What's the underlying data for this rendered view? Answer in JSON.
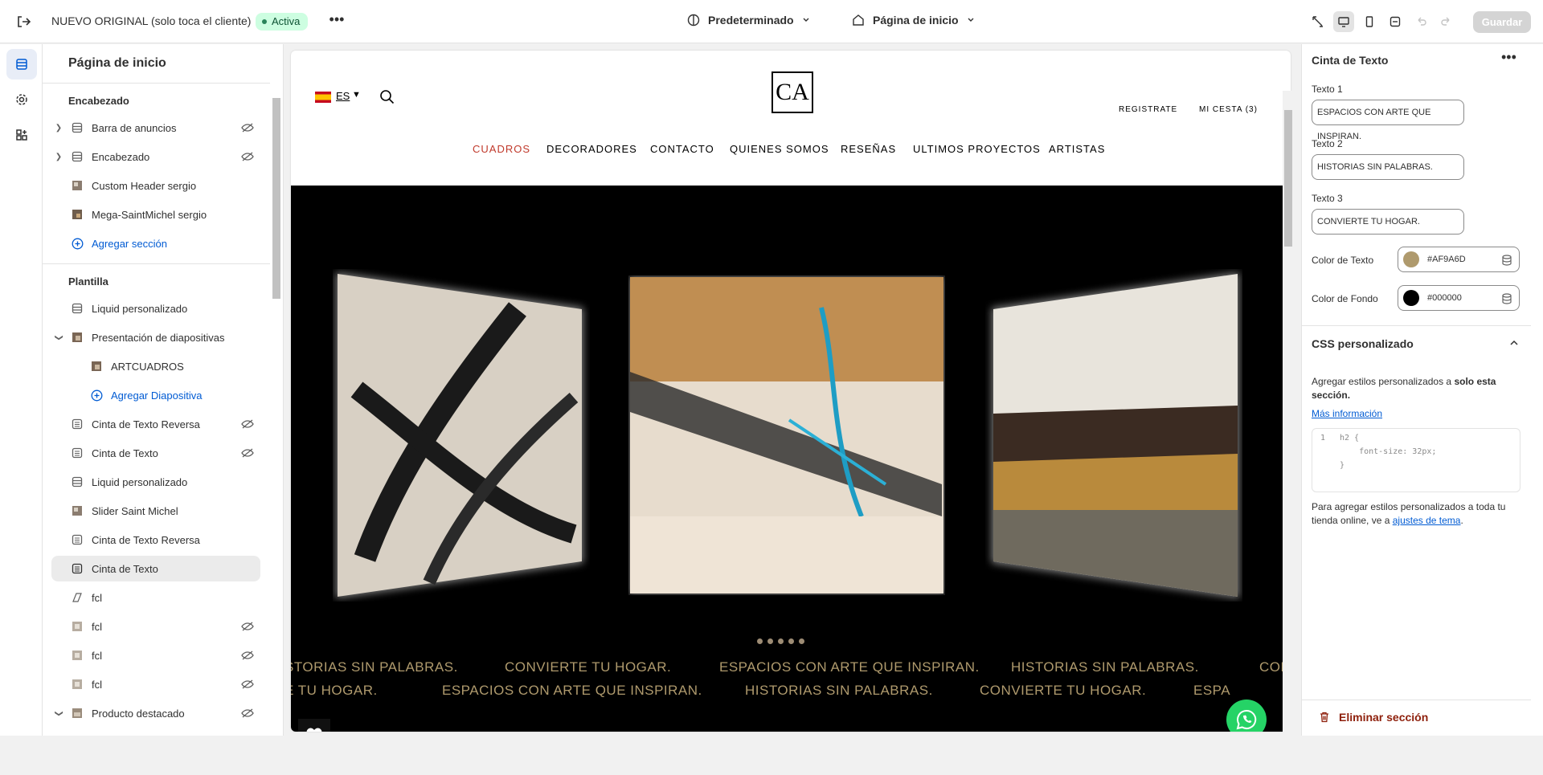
{
  "topbar": {
    "store_name": "NUEVO ORIGINAL (solo toca el cliente)",
    "status": "Activa",
    "theme_selector": "Predeterminado",
    "page_selector": "Página de inicio",
    "save_label": "Guardar"
  },
  "sidebar": {
    "title": "Página de inicio",
    "header_group": "Encabezado",
    "header_items": [
      {
        "label": "Barra de anuncios"
      },
      {
        "label": "Encabezado"
      },
      {
        "label": "Custom Header sergio"
      },
      {
        "label": "Mega-SaintMichel sergio"
      }
    ],
    "add_section": "Agregar sección",
    "template_group": "Plantilla",
    "template_items": [
      {
        "label": "Liquid personalizado"
      },
      {
        "label": "Presentación de diapositivas"
      },
      {
        "label": "ARTCUADROS"
      },
      {
        "label": "Agregar Diapositiva"
      },
      {
        "label": "Cinta de Texto Reversa"
      },
      {
        "label": "Cinta de Texto"
      },
      {
        "label": "Liquid personalizado"
      },
      {
        "label": "Slider Saint Michel"
      },
      {
        "label": "Cinta de Texto Reversa"
      },
      {
        "label": "Cinta de Texto"
      },
      {
        "label": "fcl"
      },
      {
        "label": "fcl"
      },
      {
        "label": "fcl"
      },
      {
        "label": "fcl"
      },
      {
        "label": "Producto destacado"
      }
    ]
  },
  "preview": {
    "language": "ES",
    "logo_text": "CA",
    "header_links": {
      "register": "REGISTRATE",
      "cart": "MI CESTA (3)"
    },
    "nav": [
      "CUADROS",
      "DECORADORES",
      "CONTACTO",
      "QUIENES SOMOS",
      "RESEÑAS",
      "ULTIMOS PROYECTOS",
      "ARTISTAS"
    ],
    "ticker_row1": [
      "STORIAS SIN PALABRAS.",
      "CONVIERTE TU HOGAR.",
      "ESPACIOS CON ARTE QUE INSPIRAN.",
      "HISTORIAS SIN PALABRAS.",
      "CON"
    ],
    "ticker_row2": [
      "E TU HOGAR.",
      "ESPACIOS CON ARTE QUE INSPIRAN.",
      "HISTORIAS SIN PALABRAS.",
      "CONVIERTE TU HOGAR.",
      "ESPA"
    ]
  },
  "panel": {
    "title": "Cinta de Texto",
    "fields": {
      "text1_label": "Texto 1",
      "text1_value": "ESPACIOS CON ARTE QUE INSPIRAN.",
      "text2_label": "Texto 2",
      "text2_value": "HISTORIAS SIN PALABRAS.",
      "text3_label": "Texto 3",
      "text3_value": "CONVIERTE TU HOGAR.",
      "text_color_label": "Color de Texto",
      "text_color_value": "#AF9A6D",
      "bg_color_label": "Color de Fondo",
      "bg_color_value": "#000000"
    },
    "css_title": "CSS personalizado",
    "css_desc_1": "Agregar estilos personalizados a ",
    "css_desc_bold": "solo esta sección.",
    "css_more": "Más información",
    "code_line_no": "1",
    "code_lines": [
      "h2 {",
      "    font-size: 32px;",
      "}"
    ],
    "css_note_1": "Para agregar estilos personalizados a toda tu tienda online, ve a ",
    "css_note_link": "ajustes de tema",
    "css_note_end": ".",
    "delete_label": "Eliminar sección"
  },
  "colors": {
    "accent": "#005bd3",
    "ticker": "#af9a6d",
    "status_bg": "#cdfee1",
    "danger": "#8e1f0b"
  }
}
